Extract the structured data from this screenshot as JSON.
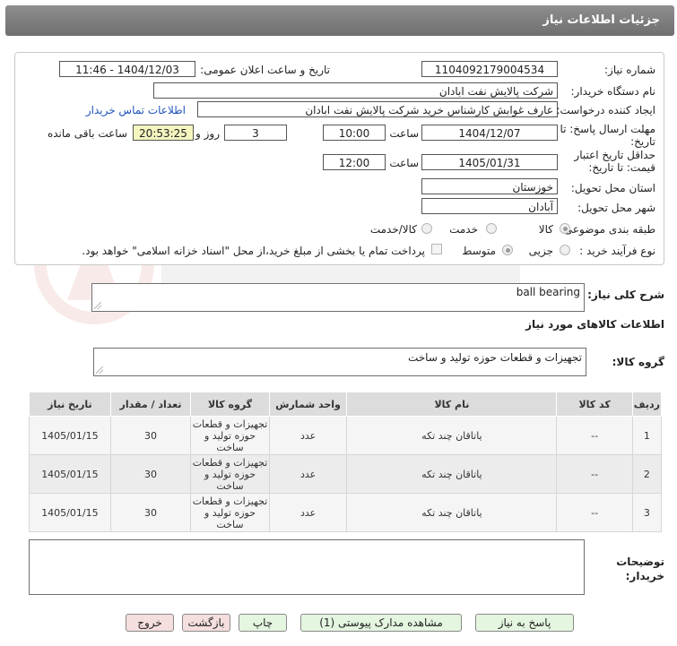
{
  "header": {
    "title": "جزئیات اطلاعات نیاز"
  },
  "form": {
    "need_number_label": "شماره نیاز:",
    "need_number": "1104092179004534",
    "announce_label": "تاریخ و ساعت اعلان عمومی:",
    "announce_value": "1404/12/03 - 11:46",
    "buyer_org_label": "نام دستگاه خریدار:",
    "buyer_org": "شرکت پالایش نفت ابادان",
    "requester_label": "ایجاد کننده درخواست:",
    "requester": "عارف غوابش کارشناس خرید شرکت پالایش نفت ابادان",
    "contact_link": "اطلاعات تماس خریدار",
    "deadline_label_1": "مهلت ارسال پاسخ: تا",
    "deadline_label_2": "تاریخ:",
    "deadline_date": "1404/12/07",
    "time_label": "ساعت",
    "deadline_time": "10:00",
    "days_value": "3",
    "days_label": "روز و",
    "remaining_time": "20:53:25",
    "remaining_label": "ساعت باقی مانده",
    "validity_label_1": "حداقل تاریخ اعتبار",
    "validity_label_2": "قیمت: تا تاریخ:",
    "validity_date": "1405/01/31",
    "validity_time": "12:00",
    "province_label": "استان محل تحویل:",
    "province": "خوزستان",
    "city_label": "شهر محل تحویل:",
    "city": "آبادان",
    "category_label": "طبقه بندی موضوعی:",
    "category_options": [
      "کالا",
      "خدمت",
      "کالا/خدمت"
    ],
    "process_label": "نوع فرآیند خرید :",
    "process_options": [
      "جزیی",
      "متوسط"
    ],
    "payment_note": "پرداخت تمام یا بخشی از مبلغ خرید،از محل \"اسناد خزانه اسلامی\" خواهد بود."
  },
  "general_desc": {
    "label": "شرح کلی نیاز:",
    "value": "ball bearing"
  },
  "goods_info_title": "اطلاعات کالاهای مورد نیاز",
  "goods_group": {
    "label": "گروه کالا:",
    "value": "تجهیزات و قطعات حوزه تولید و ساخت"
  },
  "table": {
    "headers": [
      "ردیف",
      "کد کالا",
      "نام کالا",
      "واحد شمارش",
      "گروه کالا",
      "تعداد / مقدار",
      "تاریخ نیاز"
    ],
    "rows": [
      [
        "1",
        "--",
        "یاتاقان چند تکه",
        "عدد",
        "تجهیزات و قطعات حوزه تولید و ساخت",
        "30",
        "1405/01/15"
      ],
      [
        "2",
        "--",
        "یاتاقان چند تکه",
        "عدد",
        "تجهیزات و قطعات حوزه تولید و ساخت",
        "30",
        "1405/01/15"
      ],
      [
        "3",
        "--",
        "یاتاقان چند تکه",
        "عدد",
        "تجهیزات و قطعات حوزه تولید و ساخت",
        "30",
        "1405/01/15"
      ]
    ]
  },
  "buyer_notes": {
    "label_1": "توضیحات",
    "label_2": "خریدار:",
    "value": ""
  },
  "buttons": {
    "reply": "پاسخ به نیاز",
    "attachments": "مشاهده مدارک پیوستی (1)",
    "print": "چاپ",
    "back": "بازگشت",
    "exit": "خروج"
  }
}
